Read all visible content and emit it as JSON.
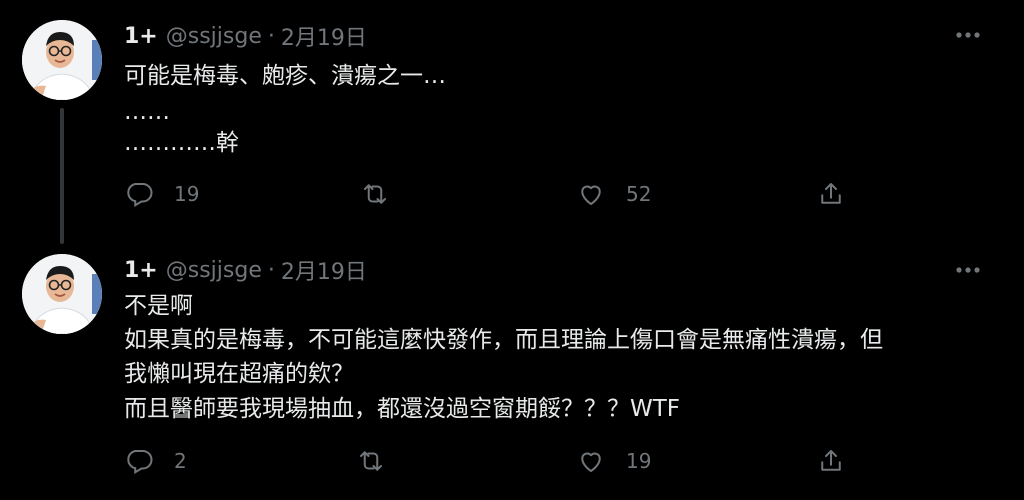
{
  "tweets": [
    {
      "name": "1+",
      "handle": "@ssjjsge",
      "separator": "·",
      "date": "2月19日",
      "lines": [
        "可能是梅毒、皰疹、潰瘍之一…",
        "……",
        "…………幹"
      ],
      "replies": "19",
      "retweets": "",
      "likes": "52"
    },
    {
      "name": "1+",
      "handle": "@ssjjsge",
      "separator": "·",
      "date": "2月19日",
      "lines": [
        "不是啊",
        "如果真的是梅毒，不可能這麼快發作，而且理論上傷口會是無痛性潰瘍，但",
        "我懶叫現在超痛的欸？",
        "而且醫師要我現場抽血，都還沒過空窗期餒？？？WTF"
      ],
      "replies": "2",
      "retweets": "",
      "likes": "19"
    }
  ],
  "icons": {
    "more": "more-horizontal-icon",
    "reply": "reply-bubble-icon",
    "retweet": "retweet-icon",
    "like": "heart-icon",
    "share": "share-icon"
  }
}
